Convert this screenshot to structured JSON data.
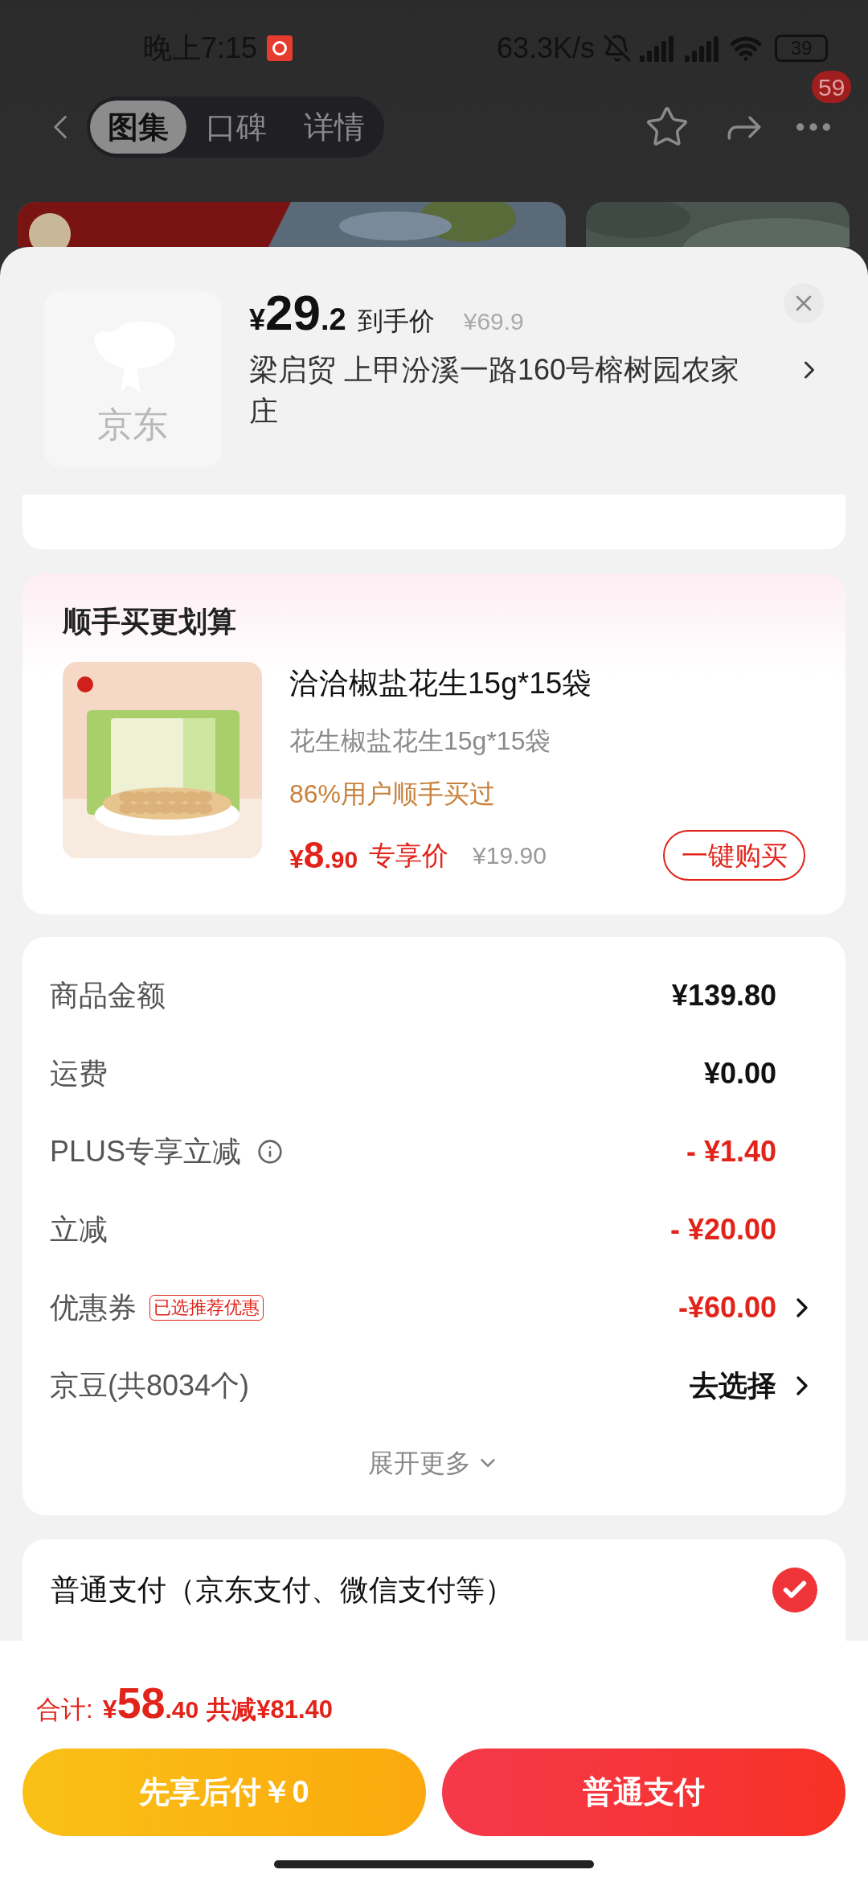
{
  "status_bar": {
    "time": "晚上7:15",
    "net_speed": "63.3K/s",
    "battery": "39"
  },
  "nav": {
    "tabs": [
      {
        "label": "图集",
        "selected": true
      },
      {
        "label": "口碑",
        "selected": false
      },
      {
        "label": "详情",
        "selected": false
      }
    ],
    "badge": "59"
  },
  "sheet": {
    "logo_text": "京东",
    "price_symbol": "¥",
    "price_int": "29",
    "price_dec": ".2",
    "price_label": "到手价",
    "original_price": "¥69.9",
    "address": "梁启贸  上甲汾溪一路160号榕树园农家庄"
  },
  "bundle": {
    "title": "顺手买更划算",
    "name": "洽洽椒盐花生15g*15袋",
    "spec": "花生椒盐花生15g*15袋",
    "social": "86%用户顺手买过",
    "price_symbol": "¥",
    "price_int": "8",
    "price_dec": ".90",
    "price_label": "专享价",
    "original_price": "¥19.90",
    "button": "一键购买"
  },
  "summary": {
    "rows": [
      {
        "label": "商品金额",
        "value": "¥139.80",
        "kind": "plain"
      },
      {
        "label": "运费",
        "value": "¥0.00",
        "kind": "plain"
      },
      {
        "label": "PLUS专享立减",
        "value": "- ¥1.40",
        "kind": "discount",
        "info": true
      },
      {
        "label": "立减",
        "value": "- ¥20.00",
        "kind": "discount"
      },
      {
        "label": "优惠券",
        "tag": "已选推荐优惠",
        "value": "-¥60.00",
        "kind": "discount",
        "chevron": true
      },
      {
        "label": "京豆(共8034个)",
        "value": "去选择",
        "kind": "plain",
        "chevron": true
      }
    ],
    "expand": "展开更多"
  },
  "payment": {
    "label": "普通支付（京东支付、微信支付等）",
    "selected": true
  },
  "footer": {
    "total_label": "合计:",
    "total_symbol": "¥",
    "total_int": "58",
    "total_dec": ".40",
    "saved": "共减¥81.40",
    "buttons": [
      {
        "label": "先享后付￥0",
        "kind": "later"
      },
      {
        "label": "普通支付",
        "kind": "pay"
      }
    ]
  }
}
